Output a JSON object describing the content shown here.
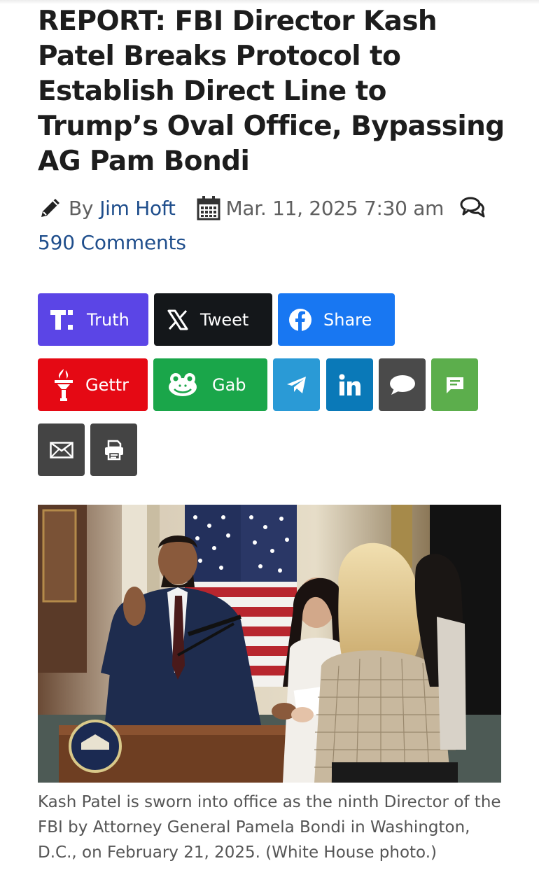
{
  "article": {
    "headline": "REPORT: FBI Director Kash Patel Breaks Protocol to Establish Direct Line to Trump’s Oval Office, Bypassing AG Pam Bondi",
    "byline_prefix": "By",
    "author": "Jim Hoft",
    "date": "Mar. 11, 2025 7:30 am",
    "comments": "590 Comments",
    "caption": "Kash Patel is sworn into office as the ninth Director of the FBI by Attorney General Pamela Bondi in Washington, D.C., on February 21, 2025. (White House photo.)"
  },
  "share": {
    "truth_label": "Truth",
    "tweet_label": "Tweet",
    "share_label": "Share",
    "gettr_label": "Gettr",
    "gab_label": "Gab"
  },
  "icons": [
    "pencil-icon",
    "calendar-icon",
    "comments-icon",
    "truth-social-icon",
    "x-icon",
    "facebook-icon",
    "gettr-icon",
    "gab-icon",
    "telegram-icon",
    "linkedin-icon",
    "sms-icon",
    "message-icon",
    "email-icon",
    "print-icon"
  ],
  "colors": {
    "truth": "#5b45e6",
    "tweet": "#14171a",
    "facebook": "#1877f2",
    "gettr": "#e50914",
    "gab": "#1aa64a",
    "telegram": "#2a9ad6",
    "linkedin": "#0a79b8",
    "sms": "#4a4a4a",
    "message": "#5cae4c",
    "email": "#444444",
    "print": "#444444",
    "link": "#1f4e8c"
  }
}
